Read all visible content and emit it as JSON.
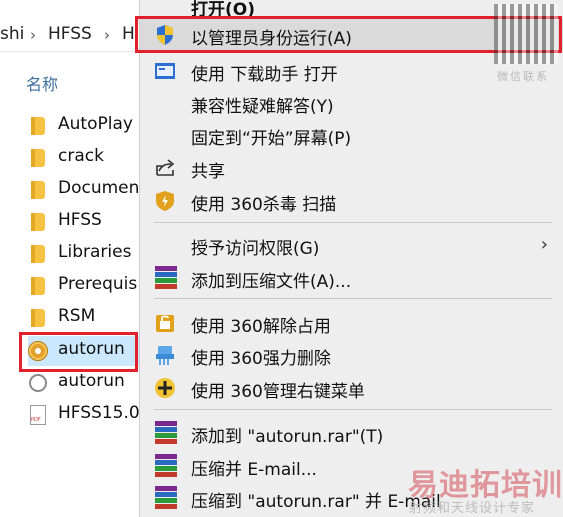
{
  "explorer": {
    "breadcrumb": [
      "shi",
      "HFSS",
      "H"
    ],
    "column_header": "名称",
    "files": [
      {
        "name": "AutoPlay",
        "type": "folder"
      },
      {
        "name": "crack",
        "type": "folder"
      },
      {
        "name": "Documen",
        "type": "folder"
      },
      {
        "name": "HFSS",
        "type": "folder"
      },
      {
        "name": "Libraries",
        "type": "folder"
      },
      {
        "name": "Prerequis",
        "type": "folder"
      },
      {
        "name": "RSM",
        "type": "folder"
      },
      {
        "name": "autorun",
        "type": "autorun-exe"
      },
      {
        "name": "autorun",
        "type": "setup-file"
      },
      {
        "name": "HFSS15.0",
        "type": "pdf"
      }
    ]
  },
  "context_menu": {
    "top_partial": "打开(O)",
    "items": [
      {
        "label": "以管理员身份运行(A)",
        "icon": "uac-shield-icon"
      },
      {
        "label": "使用 下载助手 打开",
        "icon": "download-helper-icon"
      },
      {
        "label": "兼容性疑难解答(Y)",
        "icon": ""
      },
      {
        "label": "固定到“开始”屏幕(P)",
        "icon": ""
      },
      {
        "label": "共享",
        "icon": "share-icon"
      },
      {
        "label": "使用 360杀毒 扫描",
        "icon": "360-antivirus-icon"
      },
      {
        "label": "授予访问权限(G)",
        "icon": "",
        "has_submenu": true
      },
      {
        "label": "添加到压缩文件(A)...",
        "icon": "winrar-icon"
      },
      {
        "label": "使用 360解除占用",
        "icon": "360-unlock-icon"
      },
      {
        "label": "使用 360强力删除",
        "icon": "360-shred-icon"
      },
      {
        "label": "使用 360管理右键菜单",
        "icon": "360-menu-icon"
      },
      {
        "label": "添加到 \"autorun.rar\"(T)",
        "icon": "winrar-icon"
      },
      {
        "label": "压缩并 E-mail...",
        "icon": "winrar-icon"
      },
      {
        "label": "压缩到 \"autorun.rar\" 并 E-mail",
        "icon": "winrar-icon"
      }
    ],
    "submenu_arrow": "›"
  },
  "overlay": {
    "wechat_contact": "微信联系",
    "watermark_title": "易迪拓培训",
    "watermark_sub": "射频和天线设计专家"
  },
  "colors": {
    "highlight_red": "#e0202d",
    "menu_bg": "#eeeeee",
    "header_blue": "#3c6e9e"
  }
}
